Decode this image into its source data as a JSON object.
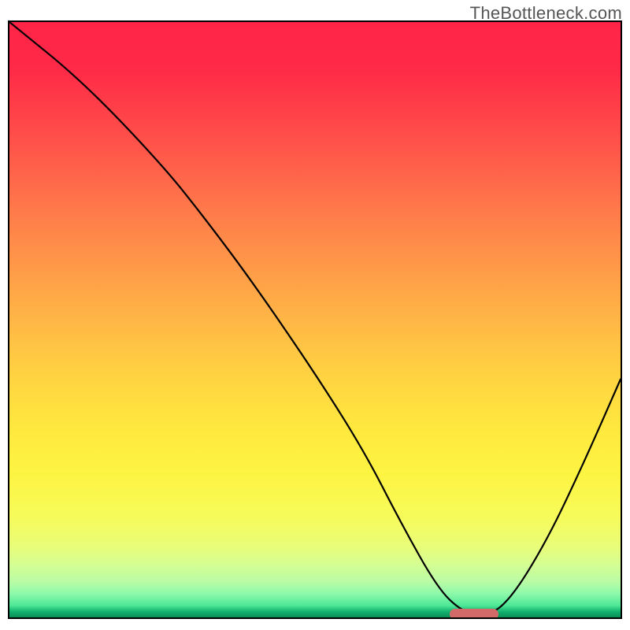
{
  "watermark": "TheBottleneck.com",
  "chart_data": {
    "type": "line",
    "title": "",
    "xlabel": "",
    "ylabel": "",
    "xlim": [
      0,
      100
    ],
    "ylim": [
      0,
      100
    ],
    "axis_ticks": {
      "x": [],
      "y": []
    },
    "grid": false,
    "background_gradient": {
      "direction": "top-to-bottom",
      "stops": [
        {
          "pos": 0,
          "color": "#ff2447"
        },
        {
          "pos": 20,
          "color": "#ff7b4a"
        },
        {
          "pos": 45,
          "color": "#ffcf42"
        },
        {
          "pos": 68,
          "color": "#ffe83e"
        },
        {
          "pos": 90,
          "color": "#d6fe92"
        },
        {
          "pos": 98,
          "color": "#4ee897"
        },
        {
          "pos": 100,
          "color": "#0a8f57"
        }
      ]
    },
    "series": [
      {
        "name": "bottleneck-curve",
        "x": [
          0,
          12,
          25,
          32,
          40,
          50,
          58,
          64,
          70,
          74,
          78,
          82,
          88,
          94,
          100
        ],
        "values": [
          100,
          90,
          76,
          67,
          56,
          41,
          28,
          16,
          5,
          1,
          0,
          3,
          13,
          26,
          40
        ]
      }
    ],
    "marker": {
      "name": "sweet-spot",
      "x_start": 72,
      "x_end": 80,
      "y": 0.5,
      "color": "#d26a6a"
    }
  }
}
